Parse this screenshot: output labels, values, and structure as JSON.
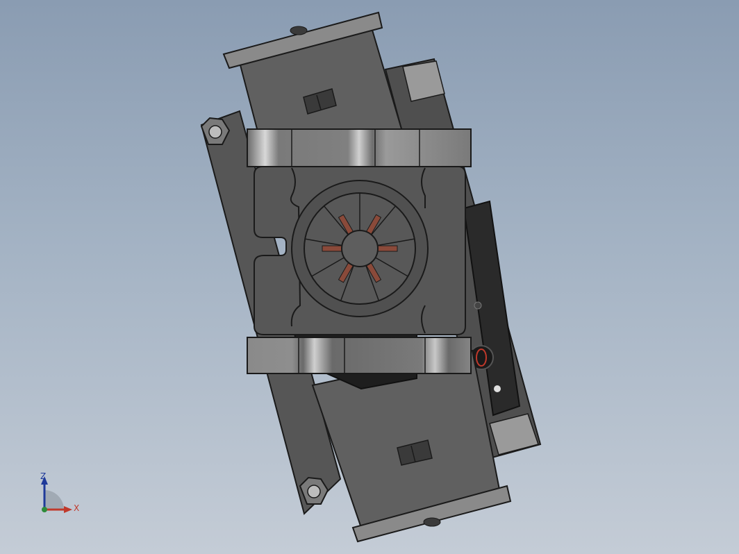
{
  "viewport": {
    "background_top": "#8a9cb2",
    "background_bottom": "#c4ccd6"
  },
  "model": {
    "body_color": "#595959",
    "edge_color": "#1a1a1a",
    "clamp_color": "#7c7c7c",
    "highlight_color": "#cfcfcf",
    "coil_color": "#8a4a3a",
    "accent_ring_color": "#c0392b"
  },
  "triad": {
    "z_label": "Z",
    "x_label": "X",
    "z_color": "#1f3a9a",
    "x_color": "#c0392b",
    "y_color": "#2e8b3a",
    "icon": "coordinate-triad-icon"
  }
}
